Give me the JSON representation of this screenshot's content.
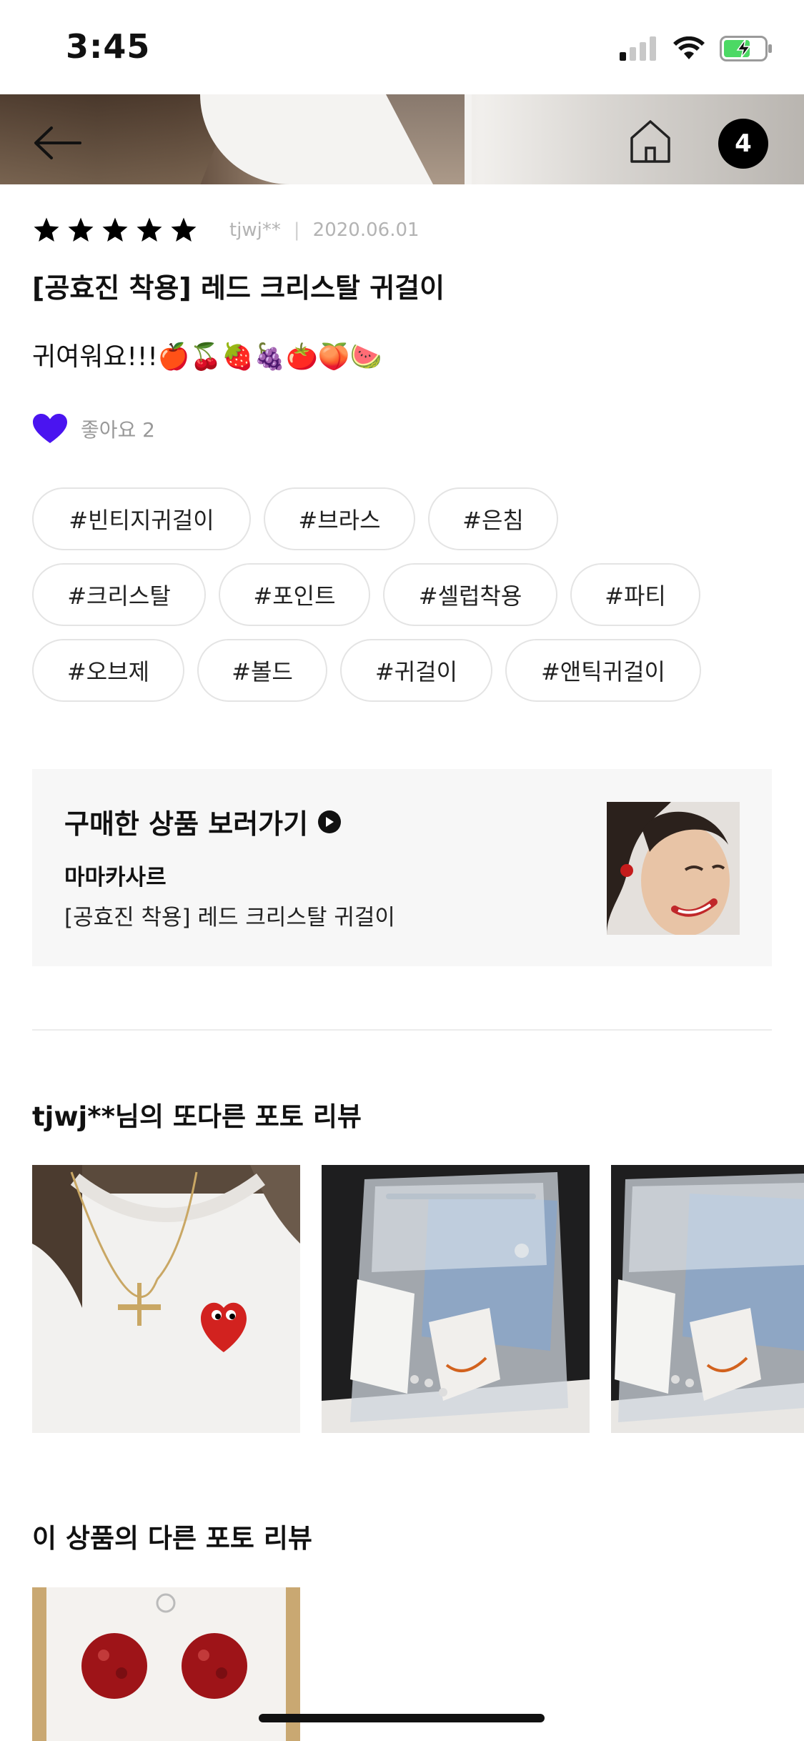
{
  "status_bar": {
    "time": "3:45"
  },
  "header": {
    "badge_count": "4"
  },
  "review": {
    "rating": 5,
    "author": "tjwj**",
    "date": "2020.06.01",
    "title": "[공효진 착용] 레드 크리스탈 귀걸이",
    "text": "귀여워요!!!🍎🍒🍓🍇🍅🍑🍉",
    "like_label": "좋아요 2"
  },
  "tags": [
    [
      "#빈티지귀걸이",
      "#브라스",
      "#은침"
    ],
    [
      "#크리스탈",
      "#포인트",
      "#셀럽착용",
      "#파티"
    ],
    [
      "#오브제",
      "#볼드",
      "#귀걸이",
      "#앤틱귀걸이"
    ]
  ],
  "product_card": {
    "title": "구매한 상품 보러가기",
    "shop": "마마카사르",
    "name": "[공효진 착용] 레드 크리스탈 귀걸이"
  },
  "sections": {
    "author_photos_title": "tjwj**님의 또다른 포토 리뷰",
    "product_photos_title": "이 상품의 다른 포토 리뷰"
  },
  "colors": {
    "like_heart": "#4a14f0",
    "text_primary": "#111111",
    "text_muted": "#b3b3b3",
    "card_bg": "#f7f7f7",
    "tag_border": "#e4e4e4"
  }
}
